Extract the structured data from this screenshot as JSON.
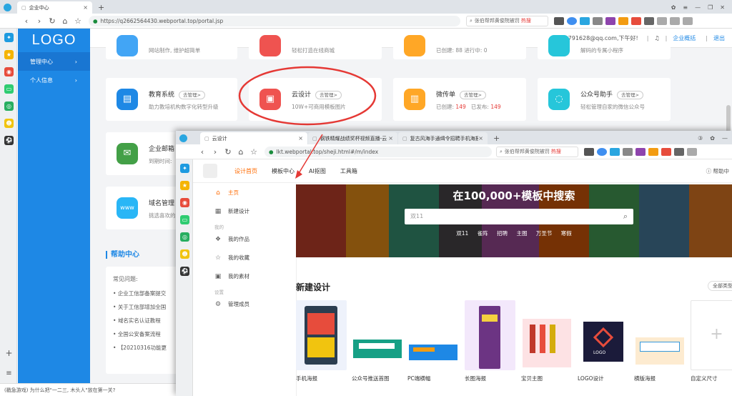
{
  "browser": {
    "tab_title": "企业中心",
    "url": "https://q2662564430.webportal.top/portal.jsp",
    "search_placeholder": "张伯帮邦黄俊院被罚",
    "hot_label": "热搜",
    "status_text": "(戳急游戏) 为什么把\"一二三, 木头人\"放在第一关?"
  },
  "portal": {
    "logo": "LOGO",
    "nav": [
      {
        "label": "管理中心"
      },
      {
        "label": "个人信息"
      }
    ],
    "user_text": "19791628@qq.com,下午好!",
    "overview_link": "企业概括",
    "logout": "退出",
    "top_row_subs": [
      "网站制作, 维护超简单",
      "轻松打造在线商城",
      "已创建: 88   进行中: 0",
      "解码的专属小程序"
    ],
    "cards": [
      {
        "title": "教育系统",
        "badge": "去管理>",
        "sub": "助力教培机构数字化转型升级",
        "color": "#1e88e5"
      },
      {
        "title": "云设计",
        "badge": "去管理>",
        "sub": "10W+可商用模板图片",
        "color": "#ef5350"
      },
      {
        "title": "微传单",
        "badge": "去管理>",
        "sub_prefix": "已创建:",
        "sub_val1": "149",
        "sub_mid": "已发布:",
        "sub_val2": "149",
        "color": "#ffa726"
      },
      {
        "title": "公众号助手",
        "badge": "去管理>",
        "sub": "轻松管理自家的微信公众号",
        "color": "#26c6da"
      },
      {
        "title": "企业邮箱",
        "sub": "到期时间:",
        "color": "#43a047"
      },
      {
        "title": "域名管理",
        "sub": "挑选喜欢的",
        "color": "#29b6f6"
      }
    ],
    "help": {
      "title": "帮助中心",
      "faq": "常见问题:",
      "items": [
        "企业工信部备案提交",
        "关于工信部增加全国",
        "域名实名认证教程",
        "全国公安备案流程",
        "【20210316功能更"
      ]
    }
  },
  "win2": {
    "tabs": [
      "云设计",
      "钢铁精耀战绩奖杯视频直播-云",
      "复古风海手通缉令招聘手机海报"
    ],
    "url": "lkt.webportal.top/sheji.html#/m/index",
    "search_placeholder": "张伯帮邦黄俊院被罚",
    "hot_label": "热搜",
    "top_nav": [
      "设计首页",
      "模板中心",
      "AI抠图",
      "工具箱"
    ],
    "help": "帮助中",
    "side": {
      "home": "主页",
      "new_design": "新建设计",
      "group_mine": "我的",
      "works": "我的作品",
      "favorites": "我的收藏",
      "materials": "我的素材",
      "group_settings": "设置",
      "members": "管理成员"
    },
    "banner": {
      "title": "在100,000+模板中搜索",
      "search_placeholder": "双11",
      "tags": [
        "双11",
        "雀阵",
        "招聘",
        "主图",
        "万圣节",
        "寒假"
      ]
    },
    "new_design_title": "新建设计",
    "all_types": "全部类型",
    "templates": [
      {
        "label": "手机海报"
      },
      {
        "label": "公众号推送首图"
      },
      {
        "label": "PC端横幅"
      },
      {
        "label": "长图海报"
      },
      {
        "label": "宝贝主图"
      },
      {
        "label": "LOGO设计"
      },
      {
        "label": "横版海报"
      },
      {
        "label": "自定义尺寸"
      }
    ]
  }
}
